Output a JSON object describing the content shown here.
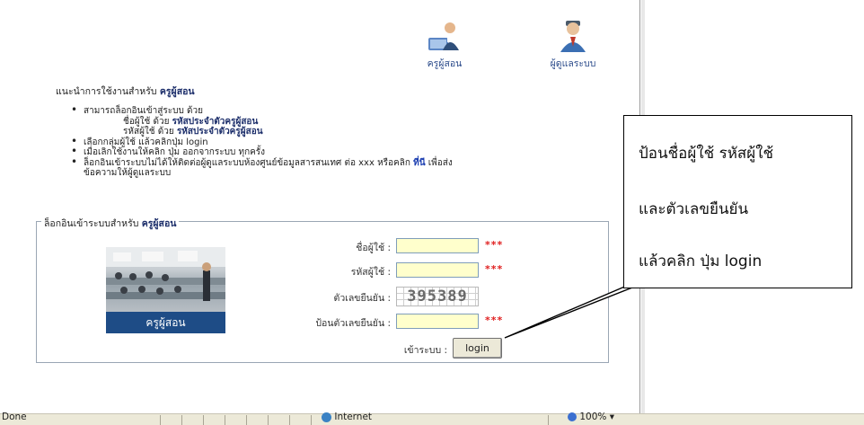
{
  "roles": [
    {
      "label": "ครูผู้สอน",
      "icon": "teacher-icon"
    },
    {
      "label": "ผู้ดูแลระบบ",
      "icon": "admin-icon"
    }
  ],
  "intro": {
    "prefix": "แนะนำการใช้งานสำหรับ",
    "role": "ครูผู้สอน"
  },
  "guide": {
    "item1": "สามารถล็อกอินเข้าสู่ระบบ ด้วย",
    "sub1_prefix": "ชื่อผู้ใช้ ด้วย",
    "sub1_value": "รหัสประจำตัวครูผู้สอน",
    "sub2_prefix": "รหัสผู้ใช้ ด้วย",
    "sub2_value": "รหัสประจำตัวครูผู้สอน",
    "item2": "เลือกกลุ่มผู้ใช้ แล้วคลิกปุ่ม login",
    "item3": "เมื่อเลิกใช้งานให้คลิก ปุ่ม ออกจากระบบ ทุกครั้ง",
    "item4_prefix": "ล็อกอินเข้าระบบไม่ได้ให้ติดต่อผู้ดูแลระบบห้องศูนย์ข้อมูลสารสนเทศ ต่อ xxx หรือคลิก",
    "item4_link": "ที่นี",
    "item4_suffix": "เพื่อส่ง",
    "item4_line2": "ข้อความให้ผู้ดูแลระบบ"
  },
  "login_box": {
    "legend_prefix": "ล็อกอินเข้าระบบสำหรับ",
    "legend_role": "ครูผู้สอน",
    "photo_caption": "ครูผู้สอน",
    "username_label": "ชื่อผู้ใช้ :",
    "username_value": "",
    "password_label": "รหัสผู้ใช้ :",
    "password_value": "",
    "captcha_label": "ตัวเลขยืนยัน :",
    "captcha_value": "395389",
    "captcha_input_label": "ป้อนตัวเลขยืนยัน :",
    "captcha_input_value": "",
    "required_mark": "***",
    "submit_label": "เข้าระบบ :",
    "login_button": "login"
  },
  "callout": {
    "line1": "ป้อนชื่อผู้ใช้ รหัสผู้ใช้",
    "line2": "และตัวเลขยืนยัน",
    "line3": "แล้วคลิก ปุ่ม login"
  },
  "statusbar": {
    "status": "Done",
    "zone": "Internet",
    "zoom": "100%"
  }
}
